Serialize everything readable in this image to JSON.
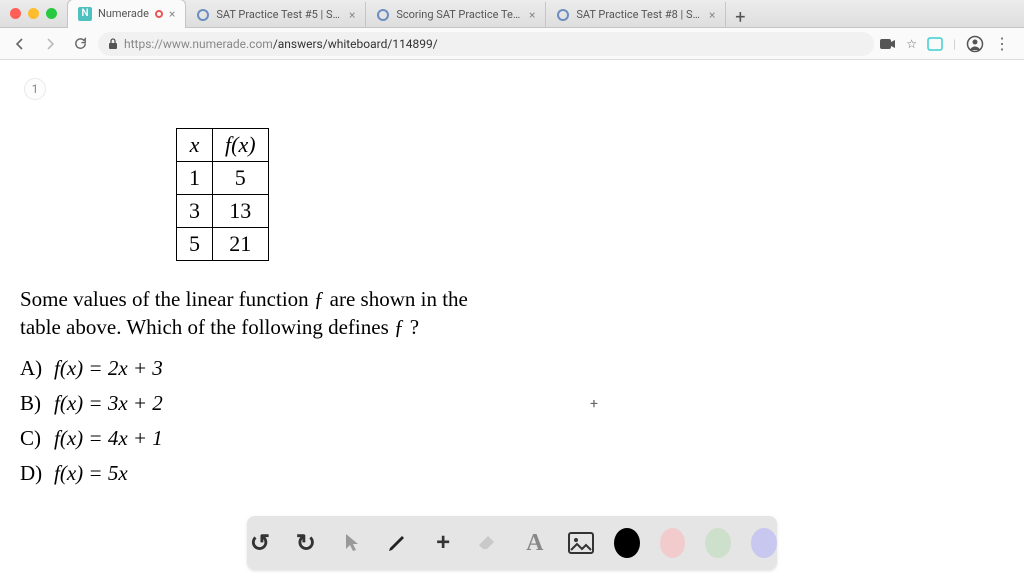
{
  "tabs": [
    {
      "title": "Numerade",
      "active": true
    },
    {
      "title": "SAT Practice Test #5 | SAT Su"
    },
    {
      "title": "Scoring SAT Practice Test 5 | S"
    },
    {
      "title": "SAT Practice Test #8 | SAT Su"
    }
  ],
  "url": {
    "host": "https://www.numerade.com",
    "path": "/answers/whiteboard/114899/"
  },
  "slide_number": "1",
  "table": {
    "header": {
      "x": "x",
      "fx": "f(x)"
    },
    "rows": [
      {
        "x": "1",
        "fx": "5"
      },
      {
        "x": "3",
        "fx": "13"
      },
      {
        "x": "5",
        "fx": "21"
      }
    ]
  },
  "question_line1": "Some values of the linear function ƒ are shown in the",
  "question_line2": "table above.  Which of the following defines ƒ ?",
  "choices": [
    {
      "label": "A)",
      "text": "f(x) = 2x + 3"
    },
    {
      "label": "B)",
      "text": "f(x) = 3x + 2"
    },
    {
      "label": "C)",
      "text": "f(x) = 4x + 1"
    },
    {
      "label": "D)",
      "text": "f(x) = 5x"
    }
  ],
  "toolbar": {
    "undo": "↺",
    "redo": "↻",
    "plus": "+",
    "text_glyph": "A"
  }
}
